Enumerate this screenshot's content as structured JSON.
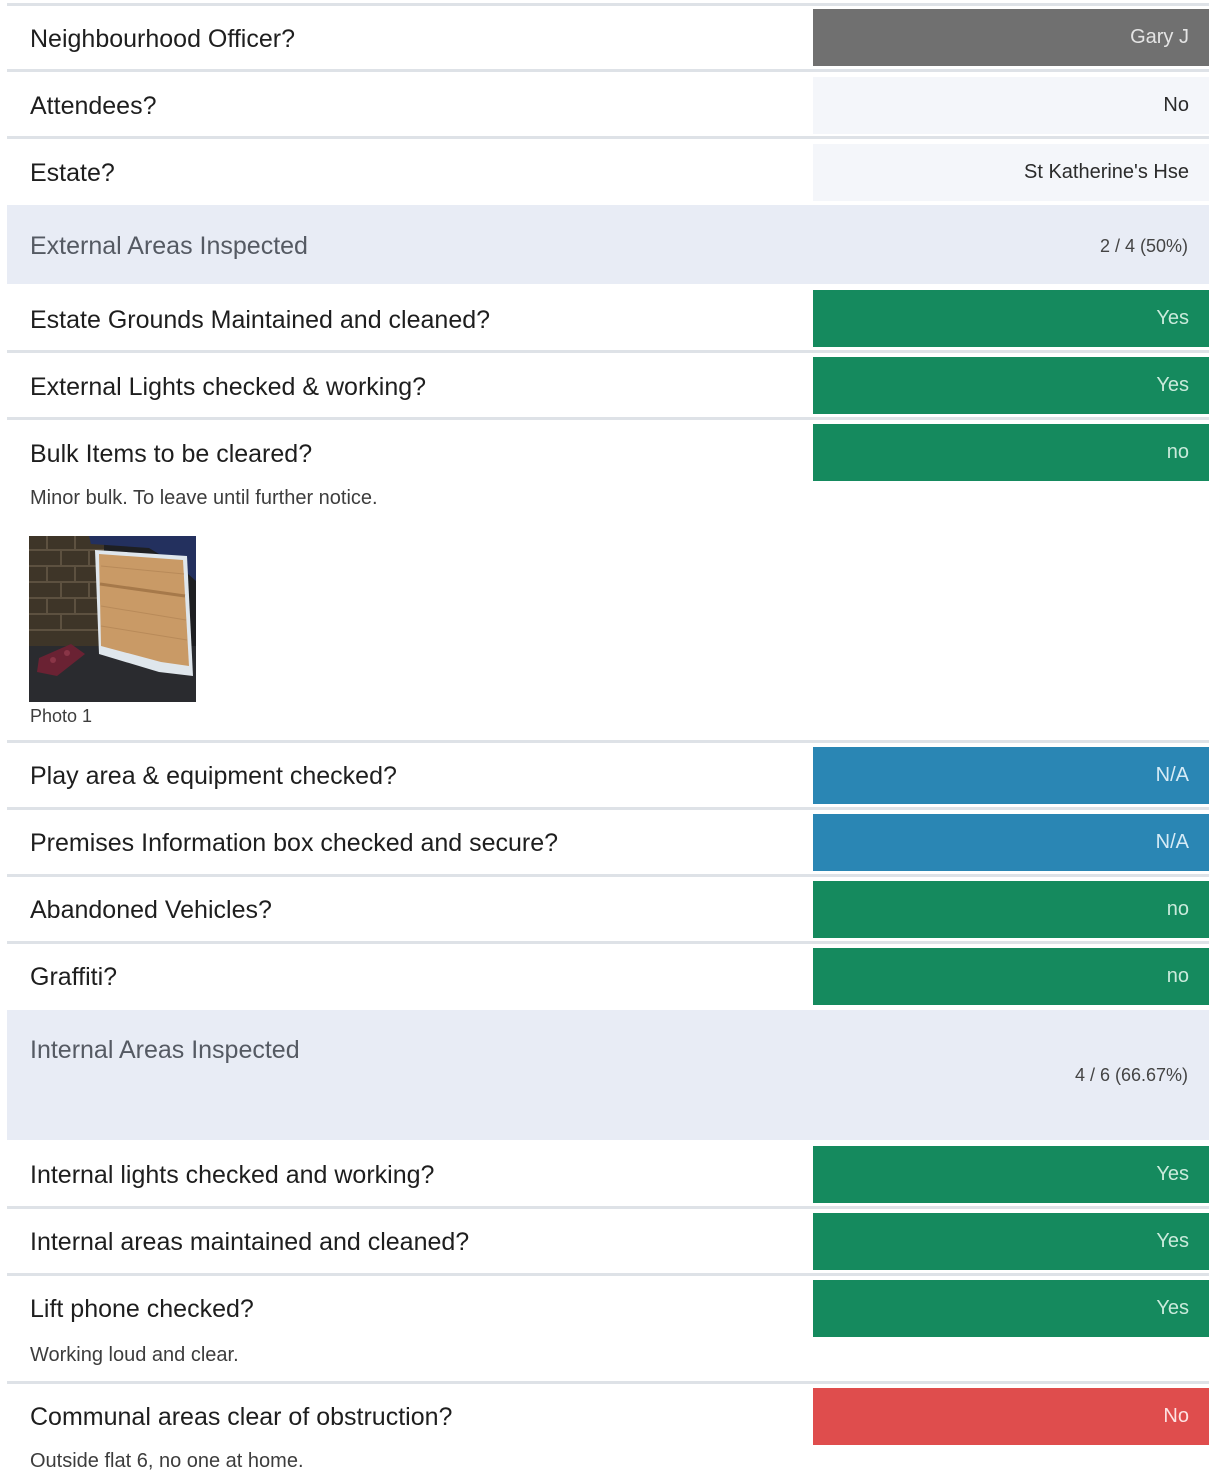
{
  "rows": {
    "officer": {
      "label": "Neighbourhood Officer?",
      "value": "Gary J"
    },
    "attendees": {
      "label": "Attendees?",
      "value": "No"
    },
    "estate": {
      "label": "Estate?",
      "value": "St Katherine's Hse"
    },
    "grounds": {
      "label": "Estate Grounds Maintained and cleaned?",
      "value": "Yes"
    },
    "ext_lights": {
      "label": "External Lights checked & working?",
      "value": "Yes"
    },
    "bulk": {
      "label": "Bulk Items to be cleared?",
      "value": "no",
      "note": "Minor bulk.  To leave until further notice.",
      "photo_caption": "Photo 1"
    },
    "play_area": {
      "label": "Play area & equipment checked?",
      "value": "N/A"
    },
    "premises_box": {
      "label": "Premises Information box checked and secure?",
      "value": "N/A"
    },
    "vehicles": {
      "label": "Abandoned Vehicles?",
      "value": "no"
    },
    "graffiti": {
      "label": "Graffiti?",
      "value": "no"
    },
    "int_lights": {
      "label": "Internal lights checked and working?",
      "value": "Yes"
    },
    "int_areas": {
      "label": "Internal areas maintained and cleaned?",
      "value": "Yes"
    },
    "lift_phone": {
      "label": "Lift phone checked?",
      "value": "Yes",
      "note": "Working loud and clear."
    },
    "communal": {
      "label": "Communal areas clear of obstruction?",
      "value": "No",
      "note": "Outside flat 6, no one at home."
    }
  },
  "sections": {
    "external": {
      "title": "External Areas Inspected",
      "score": "2 / 4 (50%)"
    },
    "internal": {
      "title": "Internal Areas Inspected",
      "score": "4 / 6 (66.67%)"
    }
  },
  "colors": {
    "pass": "#158a5e",
    "not_applicable": "#2a86b4",
    "fail": "#df4d4d",
    "officer": "#707070",
    "section_band": "#e8ecf5"
  }
}
